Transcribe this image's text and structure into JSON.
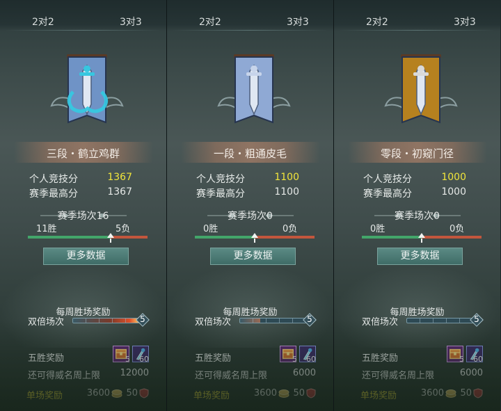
{
  "panels": [
    {
      "mode_2v2": "2对2",
      "mode_3v3": "3对3",
      "emblem": "dragon-banner-icon",
      "emblem_colors": {
        "banner": "#6f93c6",
        "accent": "#36c7e0"
      },
      "rank": "三段・鹤立鸡群",
      "stats": {
        "personal_label": "个人竞技分",
        "personal_value": "1367",
        "best_label": "赛季最高分",
        "best_value": "1367"
      },
      "season": {
        "title": "赛季场次16",
        "wins": "11胜",
        "losses": "5负",
        "win_fraction": 0.69
      },
      "more_button": "更多数据",
      "weekly": {
        "title": "每周胜场奖励",
        "double_label": "双倍场次",
        "double_count": "5",
        "double_fill_fraction": 1.0
      },
      "five_win": {
        "label": "五胜奖励",
        "chest_count": "5",
        "sword_count": "60"
      },
      "limit": {
        "label": "还可得威名周上限",
        "value": "12000"
      },
      "single": {
        "label": "单场奖励",
        "coin": "3600",
        "honor": "50"
      }
    },
    {
      "mode_2v2": "2对2",
      "mode_3v3": "3对3",
      "emblem": "sword-banner-icon",
      "emblem_colors": {
        "banner": "#8fa9d4",
        "accent": "#c7d4ea"
      },
      "rank": "一段・粗通皮毛",
      "stats": {
        "personal_label": "个人竞技分",
        "personal_value": "1100",
        "best_label": "赛季最高分",
        "best_value": "1100"
      },
      "season": {
        "title": "赛季场次0",
        "wins": "0胜",
        "losses": "0负",
        "win_fraction": 0.5
      },
      "more_button": "更多数据",
      "weekly": {
        "title": "每周胜场奖励",
        "double_label": "双倍场次",
        "double_count": "5",
        "double_fill_fraction": 0.3
      },
      "five_win": {
        "label": "五胜奖励",
        "chest_count": "5",
        "sword_count": "60"
      },
      "limit": {
        "label": "还可得威名周上限",
        "value": "6000"
      },
      "single": {
        "label": "单场奖励",
        "coin": "3600",
        "honor": "50"
      }
    },
    {
      "mode_2v2": "2对2",
      "mode_3v3": "3对3",
      "emblem": "golden-sword-banner-icon",
      "emblem_colors": {
        "banner": "#b6811f",
        "accent": "#d9d9d9"
      },
      "rank": "零段・初窥门径",
      "stats": {
        "personal_label": "个人竞技分",
        "personal_value": "1000",
        "best_label": "赛季最高分",
        "best_value": "1000"
      },
      "season": {
        "title": "赛季场次0",
        "wins": "0胜",
        "losses": "0负",
        "win_fraction": 0.5
      },
      "more_button": "更多数据",
      "weekly": {
        "title": "每周胜场奖励",
        "double_label": "双倍场次",
        "double_count": "5",
        "double_fill_fraction": 0.0
      },
      "five_win": {
        "label": "五胜奖励",
        "chest_count": "5",
        "sword_count": "60"
      },
      "limit": {
        "label": "还可得威名周上限",
        "value": "6000"
      },
      "single": {
        "label": "单场奖励",
        "coin": "3600",
        "honor": "50"
      }
    }
  ]
}
